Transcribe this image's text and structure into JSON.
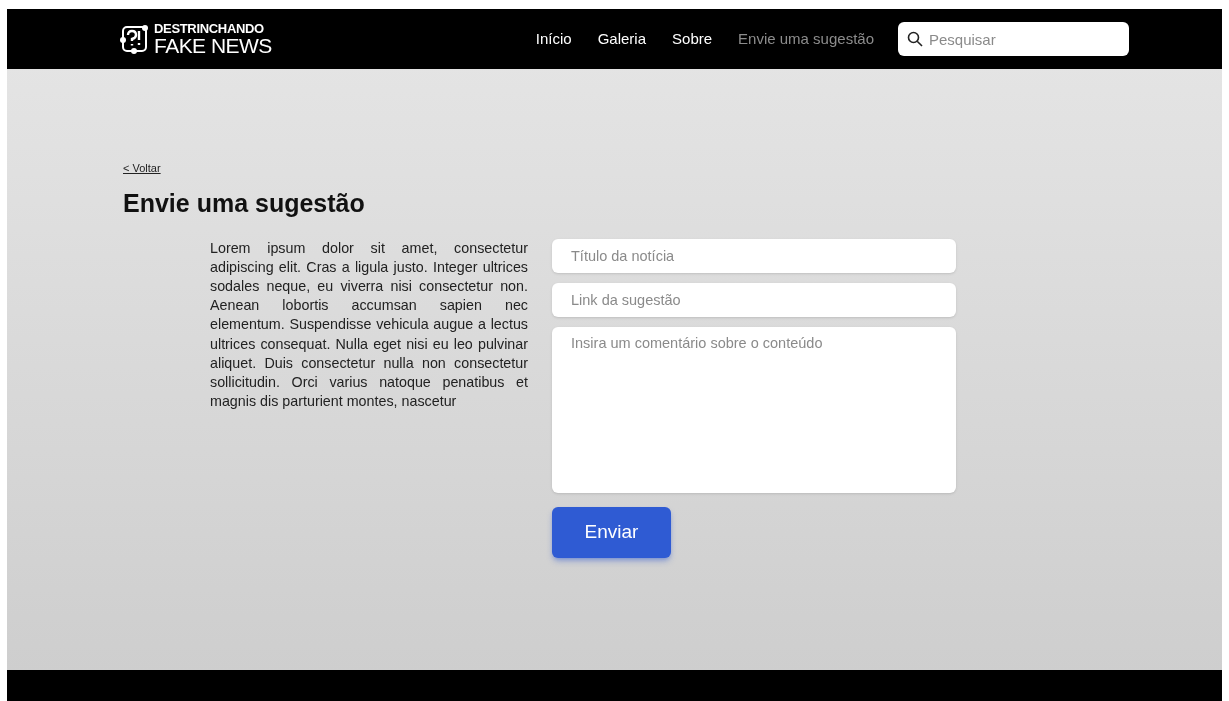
{
  "logo": {
    "line_1": "DESTRINCHANDO",
    "line_2": "FAKE NEWS"
  },
  "nav": [
    {
      "label": "Início",
      "selected": false
    },
    {
      "label": "Galeria",
      "selected": false
    },
    {
      "label": "Sobre",
      "selected": false
    },
    {
      "label": "Envie uma sugestão",
      "selected": true
    }
  ],
  "search": {
    "placeholder": "Pesquisar"
  },
  "back_link": "< Voltar",
  "title": "Envie uma sugestão",
  "body": "Lorem ipsum dolor sit amet, consectetur adipiscing elit. Cras a ligula justo. Integer ultrices sodales neque, eu viverra nisi consectetur non. Aenean lobortis accumsan sapien nec elementum. Suspendisse vehicula augue a lectus ultrices consequat. Nulla eget nisi eu leo pulvinar aliquet. Duis consectetur nulla non consectetur sollicitudin. Orci varius natoque penatibus et magnis dis parturient montes, nascetur",
  "form": {
    "fields": [
      {
        "kind": "input",
        "placeholder": "Título da notícia"
      },
      {
        "kind": "input",
        "placeholder": "Link da sugestão"
      },
      {
        "kind": "textarea",
        "placeholder": "Insira um comentário sobre o conteúdo"
      }
    ],
    "submit": "Enviar"
  }
}
